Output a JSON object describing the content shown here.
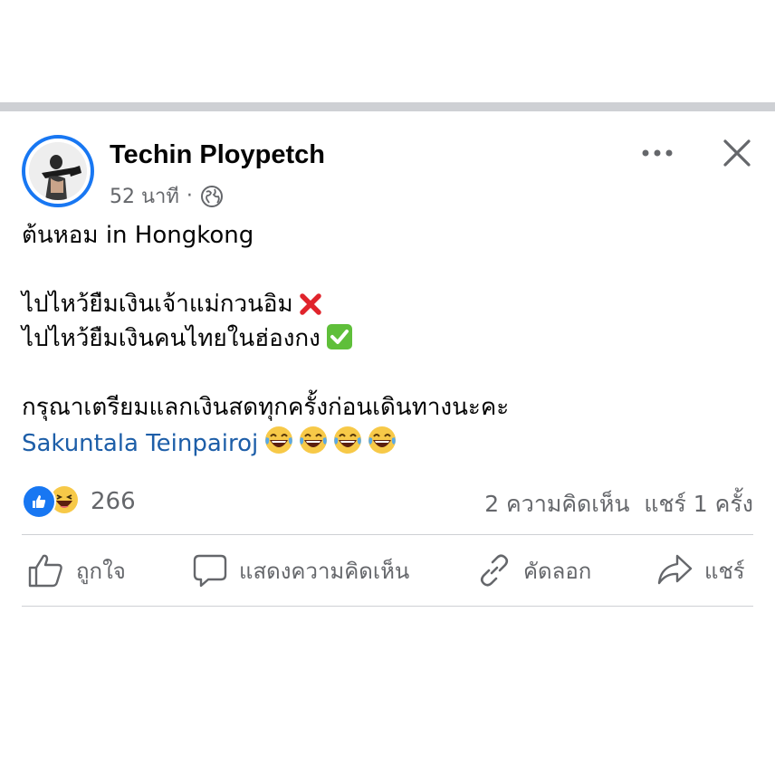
{
  "post": {
    "author": "Techin Ploypetch",
    "time": "52 นาที",
    "separator": "·",
    "privacy_icon": "globe-icon",
    "lines": [
      "ต้นหอม in Hongkong",
      "ไปไหว้ยืมเงินเจ้าแม่กวนอิม",
      "ไปไหว้ยืมเงินคนไทยในฮ่องกง",
      "กรุณาเตรียมแลกเงินสดทุกครั้งก่อนเดินทางนะคะ"
    ],
    "mention": "Sakuntala Teinpairoj",
    "line2_emoji": "cross-mark-icon",
    "line3_emoji": "check-mark-icon",
    "laugh_emoji_count": 4
  },
  "stats": {
    "reaction_count": "266",
    "comments": "2 ความคิดเห็น",
    "shares": "แชร์ 1 ครั้ง"
  },
  "actions": {
    "like": "ถูกใจ",
    "comment": "แสดงความคิดเห็น",
    "copy": "คัดลอก",
    "share": "แชร์"
  },
  "colors": {
    "accent": "#1877f2",
    "mention": "#1d5ea8",
    "secondary_text": "#65676b",
    "divider": "#ced0d4"
  }
}
